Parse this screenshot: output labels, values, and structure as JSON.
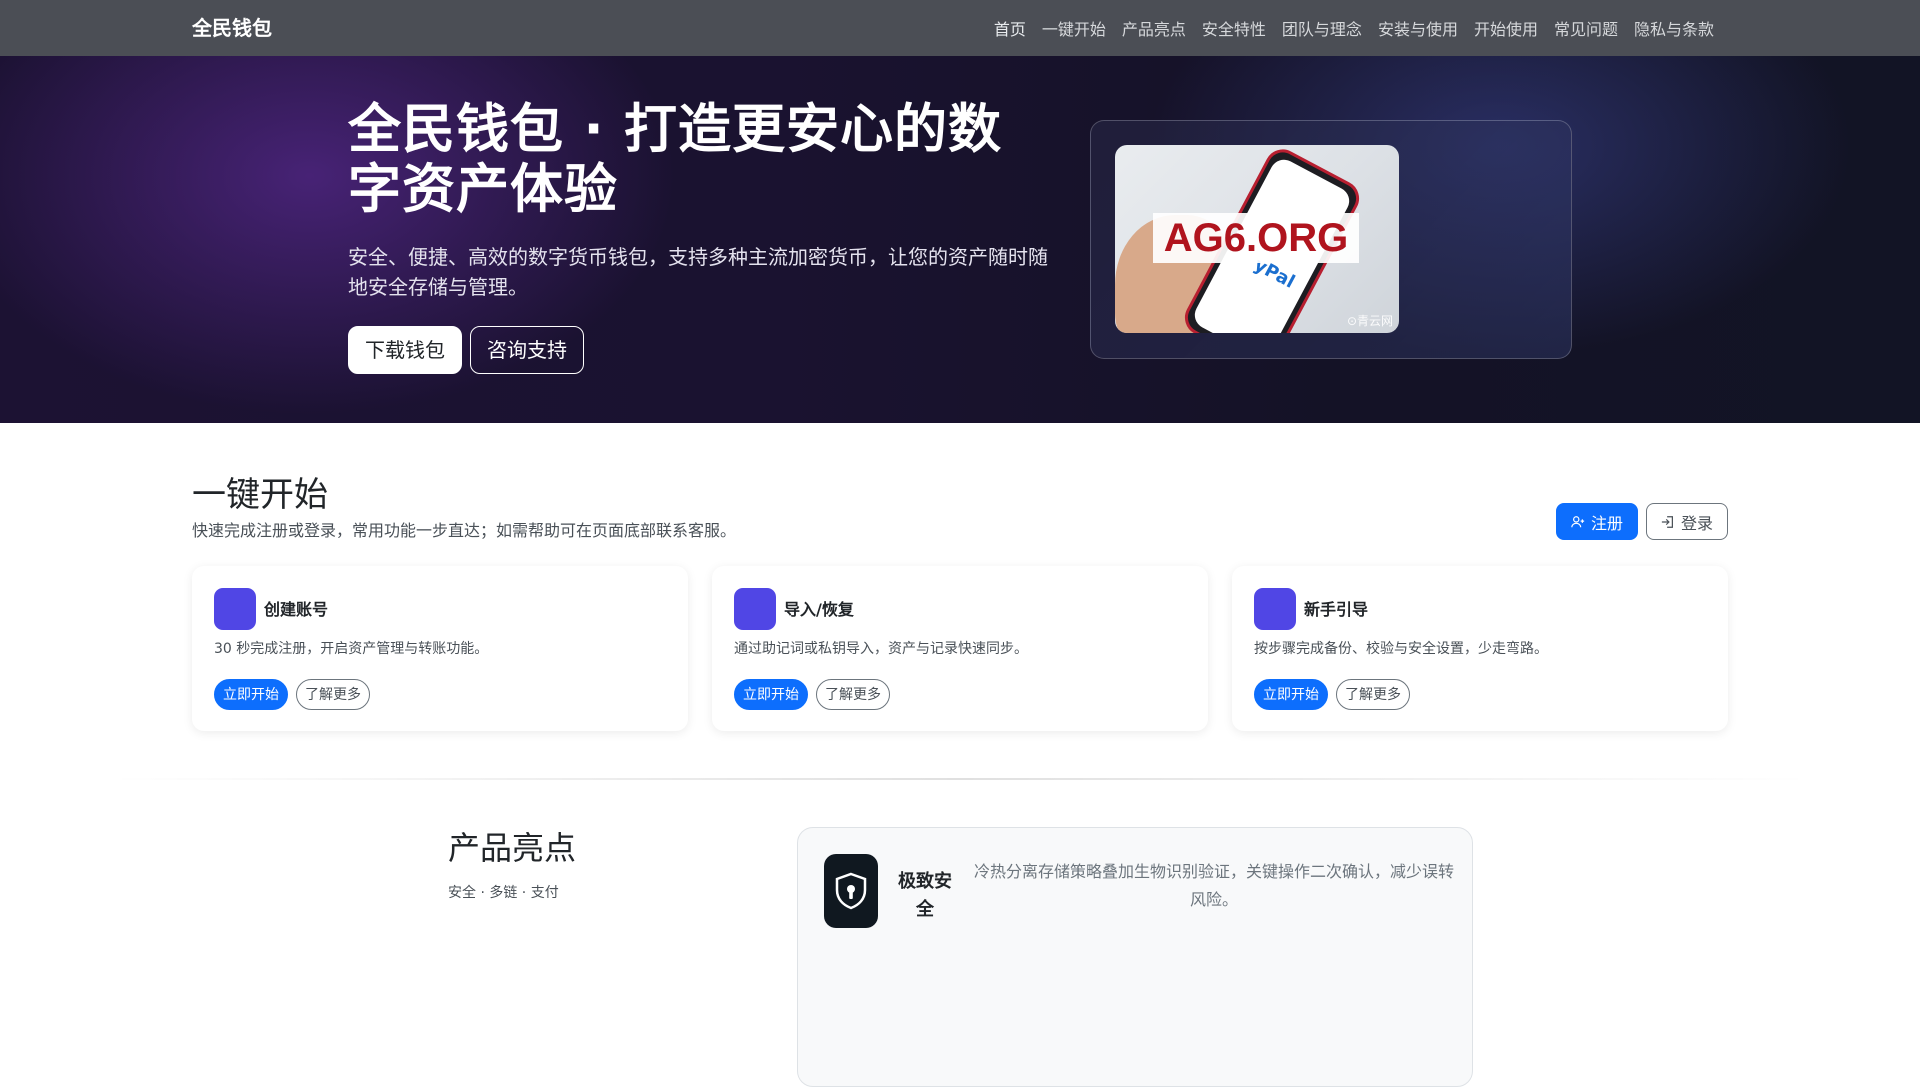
{
  "navbar": {
    "brand": "全民钱包",
    "links": [
      "首页",
      "一键开始",
      "产品亮点",
      "安全特性",
      "团队与理念",
      "安装与使用",
      "开始使用",
      "常见问题",
      "隐私与条款"
    ]
  },
  "hero": {
    "title": "全民钱包 · 打造更安心的数字资产体验",
    "subtitle": "安全、便捷、高效的数字货币钱包，支持多种主流加密货币，让您的资产随时随地安全存储与管理。",
    "download_label": "下载钱包",
    "support_label": "咨询支持",
    "image": {
      "watermark": "AG6.ORG",
      "phone_text": "yPal",
      "credit": "⊙青云网"
    }
  },
  "quick_start": {
    "title": "一键开始",
    "subtitle": "快速完成注册或登录，常用功能一步直达；如需帮助可在页面底部联系客服。",
    "register_label": "注册",
    "login_label": "登录",
    "cards": [
      {
        "title": "创建账号",
        "desc": "30 秒完成注册，开启资产管理与转账功能。",
        "start_label": "立即开始",
        "more_label": "了解更多"
      },
      {
        "title": "导入/恢复",
        "desc": "通过助记词或私钥导入，资产与记录快速同步。",
        "start_label": "立即开始",
        "more_label": "了解更多"
      },
      {
        "title": "新手引导",
        "desc": "按步骤完成备份、校验与安全设置，少走弯路。",
        "start_label": "立即开始",
        "more_label": "了解更多"
      }
    ]
  },
  "highlights": {
    "title": "产品亮点",
    "subtitle": "安全 · 多链 · 支付",
    "feature": {
      "icon": "lock-shield-icon",
      "name": "极致安全",
      "desc": "冷热分离存储策略叠加生物识别验证，关键操作二次确认，减少误转风险。"
    }
  },
  "colors": {
    "navbar": "#4b4e55",
    "primary": "#0d6efd",
    "card_icon": "#5046e5",
    "hero_bg": "#1a1230"
  }
}
